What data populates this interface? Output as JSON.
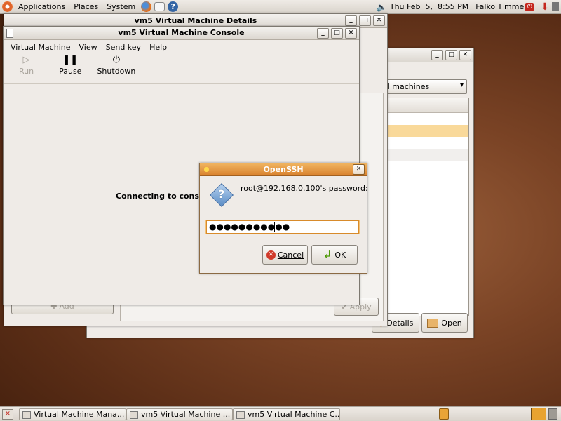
{
  "top_panel": {
    "menus": [
      "Applications",
      "Places",
      "System"
    ],
    "clock": "Thu Feb  5,  8:55 PM",
    "user": "Falko Timme"
  },
  "details_window": {
    "title": "vm5 Virtual Machine Details"
  },
  "manager_window": {
    "combo_value": "ual machines",
    "buttons": {
      "details": "Details",
      "open": "Open"
    }
  },
  "console_window": {
    "title": "vm5 Virtual Machine Console",
    "menus": [
      "Virtual Machine",
      "View",
      "Send key",
      "Help"
    ],
    "toolbar": {
      "run": "Run",
      "pause": "Pause",
      "shutdown": "Shutdown"
    },
    "status_text": "Connecting to conso",
    "add_label": "Add",
    "apply_label": "Apply"
  },
  "dialog": {
    "title": "OpenSSH",
    "prompt": "root@192.168.0.100's password:",
    "password_mask": "●●●●●●●●●●●",
    "cancel_label": "Cancel",
    "ok_label": "OK"
  },
  "taskbar": {
    "items": [
      "Virtual Machine Mana...",
      "vm5 Virtual Machine ...",
      "vm5 Virtual Machine C..."
    ]
  },
  "colors": {
    "dialog_title": "#d9822e",
    "selected_row": "#f9d99a",
    "focus_border": "#d88b2b"
  }
}
